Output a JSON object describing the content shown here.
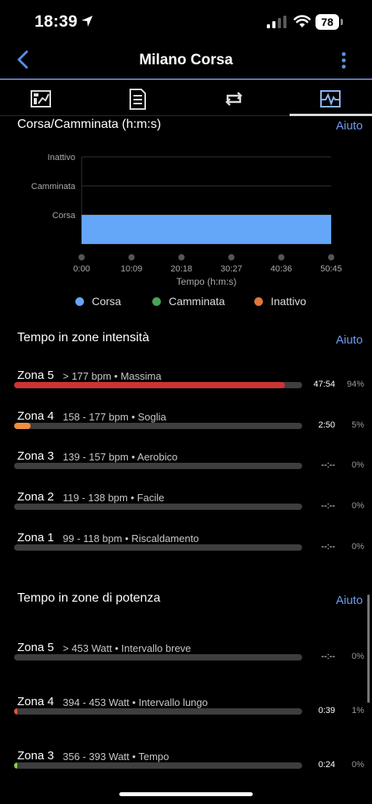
{
  "status": {
    "time": "18:39",
    "battery": "78"
  },
  "nav": {
    "title": "Milano Corsa"
  },
  "tabs": [
    {
      "name": "summary",
      "icon": "chart-summary-icon"
    },
    {
      "name": "details",
      "icon": "document-list-icon"
    },
    {
      "name": "laps",
      "icon": "loop-arrows-icon"
    },
    {
      "name": "graphs",
      "icon": "activity-graph-icon",
      "active": true
    }
  ],
  "run_walk": {
    "title": "Corsa/Camminata (h:m:s)",
    "help": "Aiuto",
    "chart_data": {
      "type": "bar",
      "orientation": "horizontal-timeline",
      "categories": [
        "Inattivo",
        "Camminata",
        "Corsa"
      ],
      "x_ticks": [
        "0:00",
        "10:09",
        "20:18",
        "30:27",
        "40:36",
        "50:45"
      ],
      "xlabel": "Tempo (h:m:s)",
      "xlim": [
        0,
        50.75
      ],
      "series": [
        {
          "name": "Corsa",
          "color": "#64a6f7",
          "start": 0,
          "end": 50.75,
          "category": "Corsa"
        }
      ],
      "legend": [
        {
          "name": "Corsa",
          "color": "#64a6f7"
        },
        {
          "name": "Camminata",
          "color": "#4aa356"
        },
        {
          "name": "Inattivo",
          "color": "#e0773a"
        }
      ],
      "legend_position": "bottom"
    }
  },
  "hr_zones": {
    "title": "Tempo in zone intensità",
    "help": "Aiuto",
    "zones": [
      {
        "name": "Zona 5",
        "range": "> 177 bpm",
        "label": "Massima",
        "time": "47:54",
        "pct": "94%",
        "value": 0.94,
        "color": "#cc3434"
      },
      {
        "name": "Zona 4",
        "range": "158 - 177 bpm",
        "label": "Soglia",
        "time": "2:50",
        "pct": "5%",
        "value": 0.057,
        "color": "#ee8f3e"
      },
      {
        "name": "Zona 3",
        "range": "139 - 157 bpm",
        "label": "Aerobico",
        "time": "--:--",
        "pct": "0%",
        "value": 0,
        "color": "#4aa356"
      },
      {
        "name": "Zona 2",
        "range": "119 - 138 bpm",
        "label": "Facile",
        "time": "--:--",
        "pct": "0%",
        "value": 0,
        "color": "#4d7fe0"
      },
      {
        "name": "Zona 1",
        "range": "99 - 118 bpm",
        "label": "Riscaldamento",
        "time": "--:--",
        "pct": "0%",
        "value": 0,
        "color": "#888888"
      }
    ]
  },
  "power_zones": {
    "title": "Tempo in zone di potenza",
    "help": "Aiuto",
    "zones": [
      {
        "name": "Zona 5",
        "range": "> 453 Watt",
        "label": "Intervallo breve",
        "time": "--:--",
        "pct": "0%",
        "value": 0,
        "color": "#cc3434"
      },
      {
        "name": "Zona 4",
        "range": "394 - 453 Watt",
        "label": "Intervallo lungo",
        "time": "0:39",
        "pct": "1%",
        "value": 0.012,
        "color": "#e0573a"
      },
      {
        "name": "Zona 3",
        "range": "356 - 393 Watt",
        "label": "Tempo",
        "time": "0:24",
        "pct": "0%",
        "value": 0.008,
        "color": "#8bd14a"
      }
    ]
  }
}
